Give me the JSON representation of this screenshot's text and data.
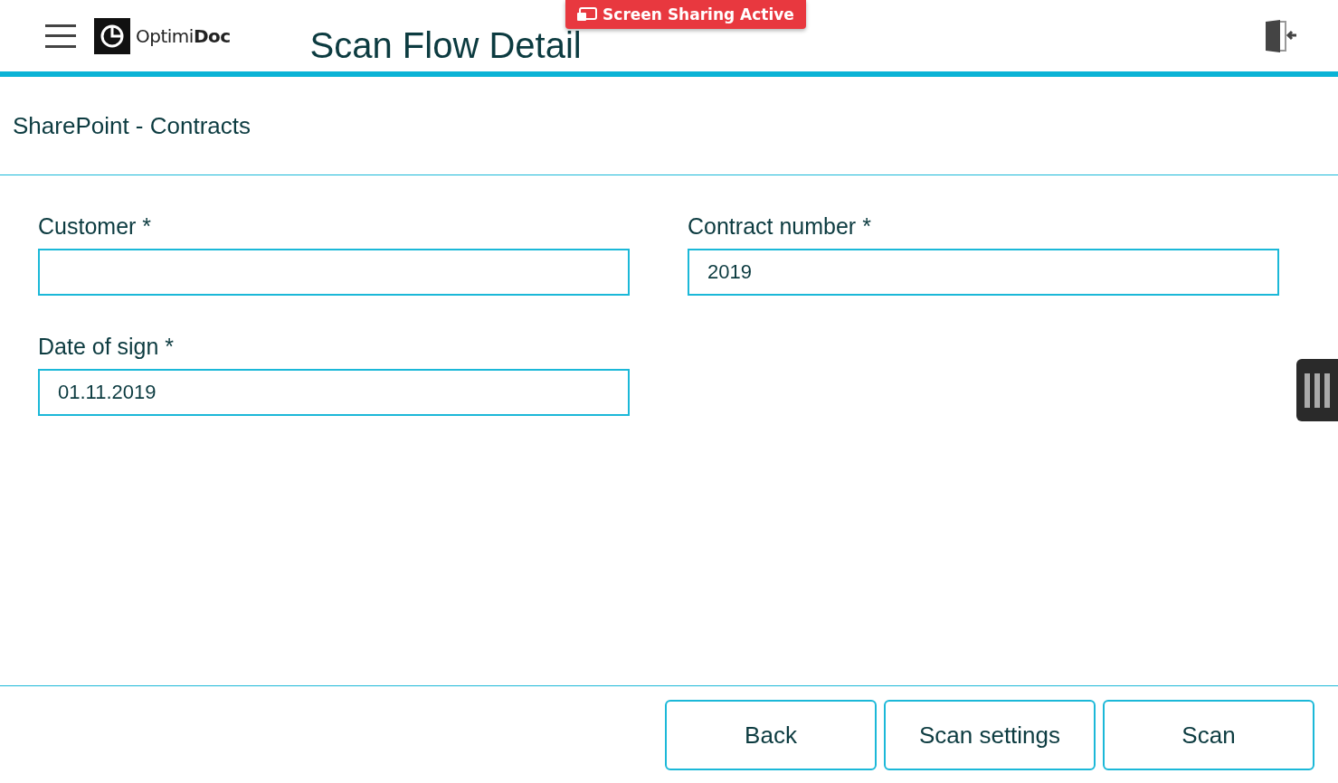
{
  "header": {
    "logo": "Optimi**Doc**",
    "title": "Scan Flow Detail"
  },
  "banner": {
    "text": "Screen Sharing Active"
  },
  "flow_name": "SharePoint - Contracts",
  "fields": [
    {
      "label": "Customer *"
    },
    {
      "label": "Contract number *",
      "value": "2019"
    },
    {
      "label": "Date of sign *",
      "value": "01.11.2019"
    }
  ],
  "buttons": [
    "Back",
    "Scan settings",
    "Scan"
  ]
}
